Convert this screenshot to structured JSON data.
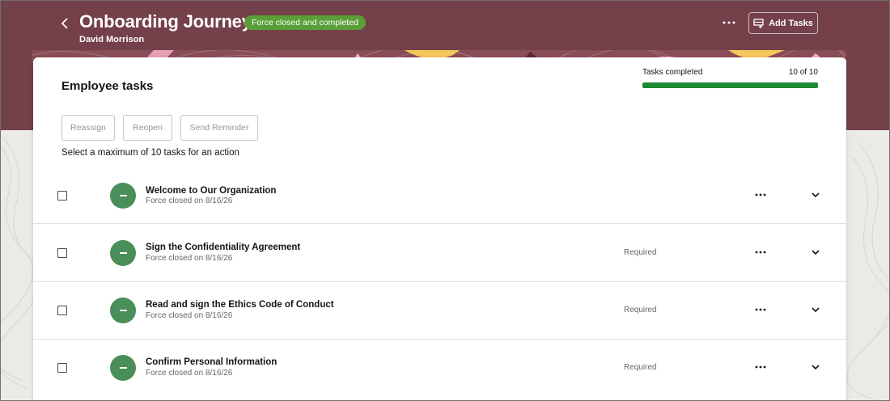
{
  "header": {
    "title": "Onboarding Journey",
    "status_badge": "Force closed and completed",
    "subtitle": "David Morrison",
    "add_tasks_label": "Add Tasks"
  },
  "card": {
    "title": "Employee tasks",
    "progress": {
      "label": "Tasks completed",
      "count_text": "10 of 10",
      "fraction": 1.0
    },
    "actions": {
      "reassign": "Reassign",
      "reopen": "Reopen",
      "send_reminder": "Send Reminder"
    },
    "helper_text": "Select a maximum of 10 tasks for an action"
  },
  "tasks": [
    {
      "title": "Welcome to Our Organization",
      "status": "Force closed on 8/16/26",
      "required": ""
    },
    {
      "title": "Sign the Confidentiality Agreement",
      "status": "Force closed on 8/16/26",
      "required": "Required"
    },
    {
      "title": "Read and sign the Ethics Code of Conduct",
      "status": "Force closed on 8/16/26",
      "required": "Required"
    },
    {
      "title": "Confirm Personal Information",
      "status": "Force closed on 8/16/26",
      "required": "Required"
    }
  ],
  "colors": {
    "banner": "#74404a",
    "badge": "#5a9e38",
    "progress_fill": "#1e8a32",
    "status_circle": "#4a8e5a"
  },
  "icons": {
    "back": "chevron-left-icon",
    "more": "ellipsis-icon",
    "add_tasks": "add-tasks-icon",
    "expand": "chevron-down-icon",
    "status": "minus-icon"
  }
}
